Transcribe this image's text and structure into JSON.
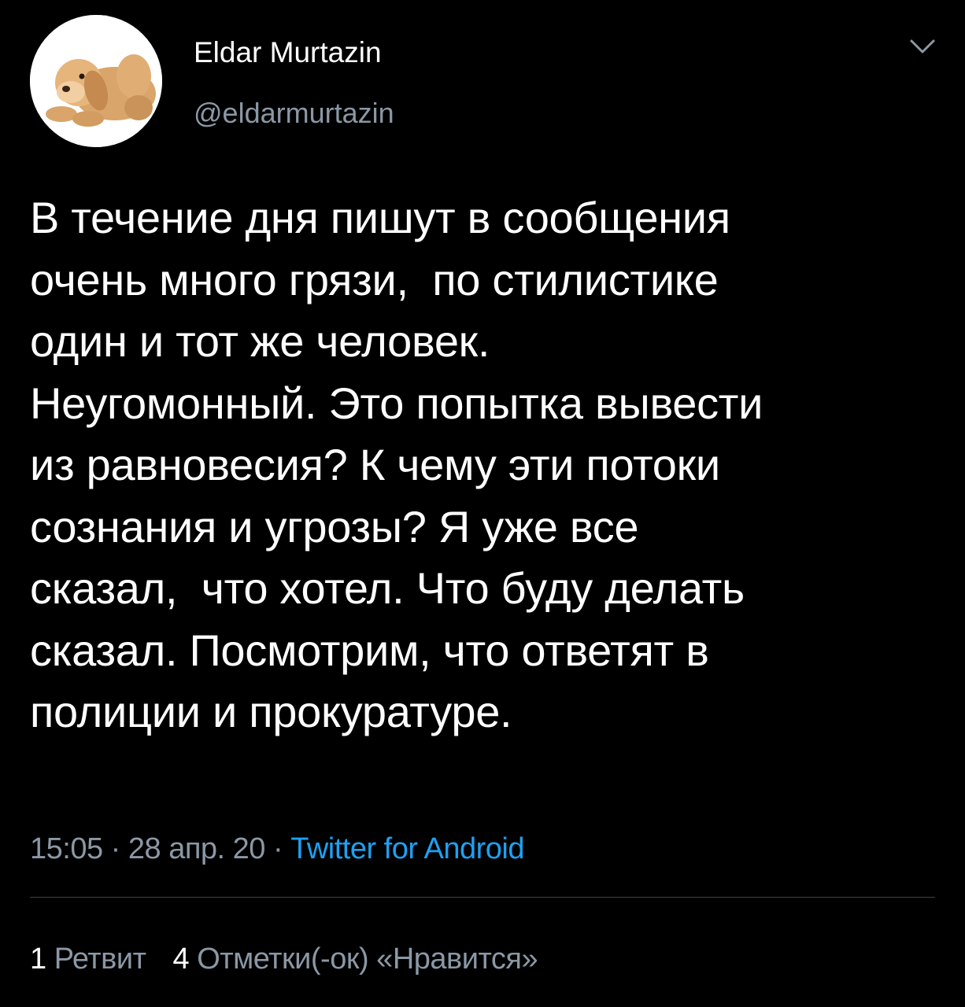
{
  "author": {
    "display_name": "Eldar Murtazin",
    "handle": "@eldarmurtazin",
    "avatar_icon": "plush-dog-avatar"
  },
  "menu": {
    "icon": "chevron-down-icon"
  },
  "tweet": {
    "text": "В течение дня пишут в сообщения\nочень много грязи,  по стилистике\nодин и тот же человек.\nНеугомонный. Это попытка вывести\nиз равновесия? К чему эти потоки\nсознания и угрозы? Я уже все\nсказал,  что хотел. Что буду делать\nсказал. Посмотрим, что ответят в\nполиции и прокуратуре."
  },
  "meta": {
    "time": "15:05",
    "separator": " · ",
    "date": "28 апр. 20",
    "source": "Twitter for Android"
  },
  "stats": {
    "retweets_count": "1",
    "retweets_label": "Ретвит",
    "likes_count": "4",
    "likes_label": "Отметки(-ок) «Нравится»"
  },
  "colors": {
    "background": "#000000",
    "text": "#ffffff",
    "secondary": "#8b98a5",
    "link": "#1da1f2",
    "divider": "#38444d"
  }
}
